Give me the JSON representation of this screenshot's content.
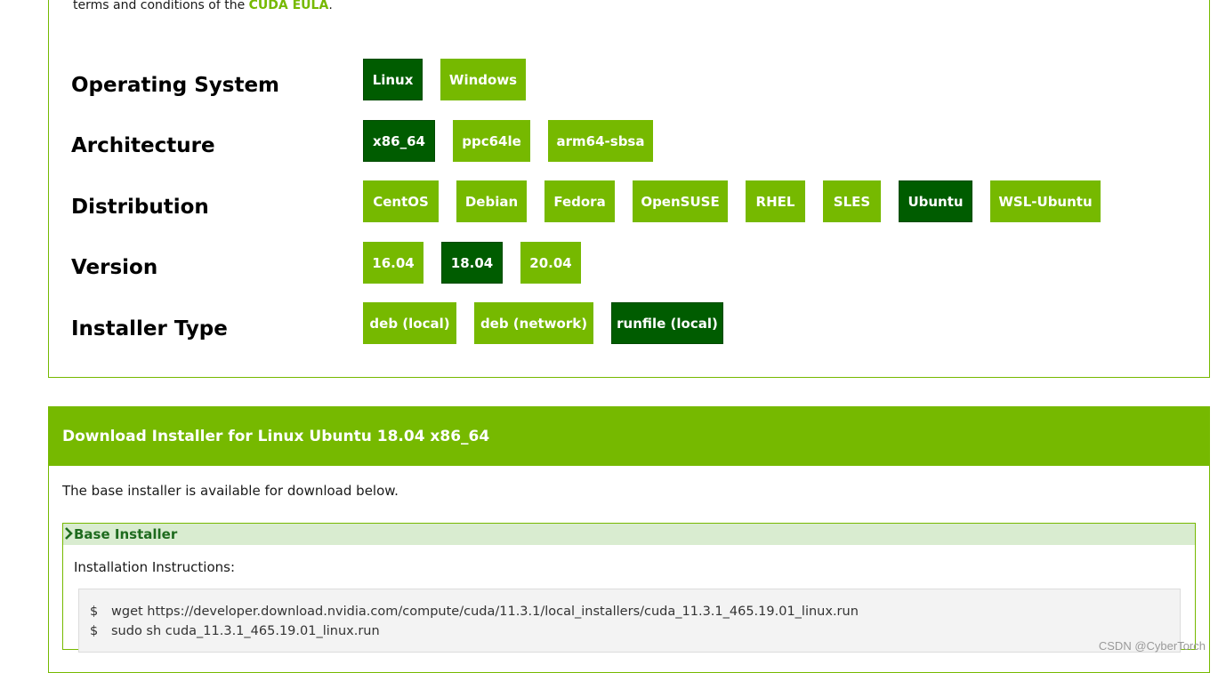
{
  "eula": {
    "prefix": "terms and conditions of the",
    "link": "CUDA EULA",
    "suffix": "."
  },
  "selectors": [
    {
      "label": "Operating System",
      "options": [
        {
          "label": "Linux",
          "selected": true
        },
        {
          "label": "Windows",
          "selected": false
        }
      ]
    },
    {
      "label": "Architecture",
      "options": [
        {
          "label": "x86_64",
          "selected": true
        },
        {
          "label": "ppc64le",
          "selected": false
        },
        {
          "label": "arm64-sbsa",
          "selected": false
        }
      ]
    },
    {
      "label": "Distribution",
      "options": [
        {
          "label": "CentOS",
          "selected": false
        },
        {
          "label": "Debian",
          "selected": false
        },
        {
          "label": "Fedora",
          "selected": false
        },
        {
          "label": "OpenSUSE",
          "selected": false
        },
        {
          "label": "RHEL",
          "selected": false
        },
        {
          "label": "SLES",
          "selected": false
        },
        {
          "label": "Ubuntu",
          "selected": true
        },
        {
          "label": "WSL-Ubuntu",
          "selected": false
        }
      ]
    },
    {
      "label": "Version",
      "options": [
        {
          "label": "16.04",
          "selected": false
        },
        {
          "label": "18.04",
          "selected": true
        },
        {
          "label": "20.04",
          "selected": false
        }
      ]
    },
    {
      "label": "Installer Type",
      "options": [
        {
          "label": "deb (local)",
          "selected": false
        },
        {
          "label": "deb (network)",
          "selected": false
        },
        {
          "label": "runfile (local)",
          "selected": true
        }
      ]
    }
  ],
  "download": {
    "header": "Download Installer for Linux Ubuntu 18.04 x86_64",
    "description": "The base installer is available for download below.",
    "base_installer": {
      "title": "Base Installer",
      "chevron_icon": "chevron-right-icon",
      "instructions_label": "Installation Instructions:",
      "commands": [
        {
          "prompt": "$",
          "text": "wget https://developer.download.nvidia.com/compute/cuda/11.3.1/local_installers/cuda_11.3.1_465.19.01_linux.run"
        },
        {
          "prompt": "$",
          "text": "sudo sh cuda_11.3.1_465.19.01_linux.run"
        }
      ]
    }
  },
  "watermark": "CSDN @CyberTorch",
  "colors": {
    "brand_green": "#76b900",
    "selected_green": "#005c00",
    "base_header_bg": "#d9ecd0"
  }
}
